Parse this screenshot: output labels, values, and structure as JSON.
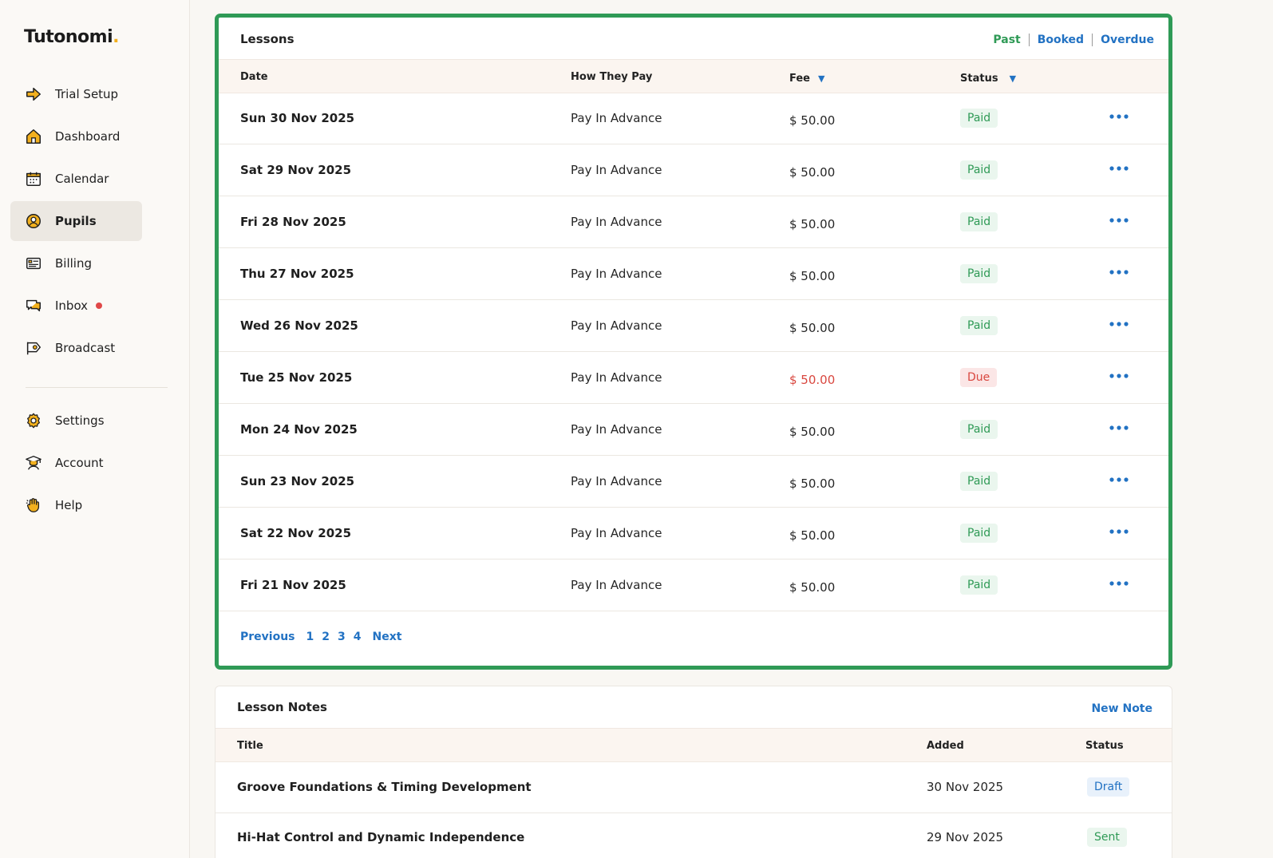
{
  "app": {
    "logo_text": "Tutonomi",
    "logo_dot": "."
  },
  "sidebar": {
    "items": [
      {
        "label": "Trial Setup",
        "icon": "arrow-right-icon"
      },
      {
        "label": "Dashboard",
        "icon": "home-icon"
      },
      {
        "label": "Calendar",
        "icon": "calendar-icon"
      },
      {
        "label": "Pupils",
        "icon": "user-circle-icon",
        "active": true
      },
      {
        "label": "Billing",
        "icon": "billing-icon"
      },
      {
        "label": "Inbox",
        "icon": "chat-icon",
        "has_unread": true
      },
      {
        "label": "Broadcast",
        "icon": "megaphone-icon"
      },
      {
        "label": "Settings",
        "icon": "gear-icon"
      },
      {
        "label": "Account",
        "icon": "graduate-icon"
      },
      {
        "label": "Help",
        "icon": "wave-hand-icon"
      }
    ]
  },
  "lessons": {
    "title": "Lessons",
    "filters": {
      "past": "Past",
      "booked": "Booked",
      "overdue": "Overdue"
    },
    "columns": {
      "date": "Date",
      "how_they_pay": "How They Pay",
      "fee": "Fee",
      "status": "Status"
    },
    "rows": [
      {
        "date": "Sun 30 Nov 2025",
        "pay": "Pay In Advance",
        "fee": "$ 50.00",
        "status": "Paid"
      },
      {
        "date": "Sat 29 Nov 2025",
        "pay": "Pay In Advance",
        "fee": "$ 50.00",
        "status": "Paid"
      },
      {
        "date": "Fri 28 Nov 2025",
        "pay": "Pay In Advance",
        "fee": "$ 50.00",
        "status": "Paid"
      },
      {
        "date": "Thu 27 Nov 2025",
        "pay": "Pay In Advance",
        "fee": "$ 50.00",
        "status": "Paid"
      },
      {
        "date": "Wed 26 Nov 2025",
        "pay": "Pay In Advance",
        "fee": "$ 50.00",
        "status": "Paid"
      },
      {
        "date": "Tue 25 Nov 2025",
        "pay": "Pay In Advance",
        "fee": "$ 50.00",
        "status": "Due"
      },
      {
        "date": "Mon 24 Nov 2025",
        "pay": "Pay In Advance",
        "fee": "$ 50.00",
        "status": "Paid"
      },
      {
        "date": "Sun 23 Nov 2025",
        "pay": "Pay In Advance",
        "fee": "$ 50.00",
        "status": "Paid"
      },
      {
        "date": "Sat 22 Nov 2025",
        "pay": "Pay In Advance",
        "fee": "$ 50.00",
        "status": "Paid"
      },
      {
        "date": "Fri 21 Nov 2025",
        "pay": "Pay In Advance",
        "fee": "$ 50.00",
        "status": "Paid"
      }
    ],
    "pagination": {
      "previous": "Previous",
      "pages": [
        "1",
        "2",
        "3",
        "4"
      ],
      "next": "Next"
    }
  },
  "notes": {
    "title": "Lesson Notes",
    "new_note": "New Note",
    "columns": {
      "title": "Title",
      "added": "Added",
      "status": "Status"
    },
    "rows": [
      {
        "title": "Groove Foundations & Timing Development",
        "added": "30 Nov 2025",
        "status": "Draft"
      },
      {
        "title": "Hi-Hat Control and Dynamic Independence",
        "added": "29 Nov 2025",
        "status": "Sent"
      }
    ]
  },
  "colors": {
    "accent_green": "#2f9a56",
    "link_blue": "#2272c3",
    "due_red": "#d9473f",
    "logo_yellow": "#f2b01e"
  }
}
